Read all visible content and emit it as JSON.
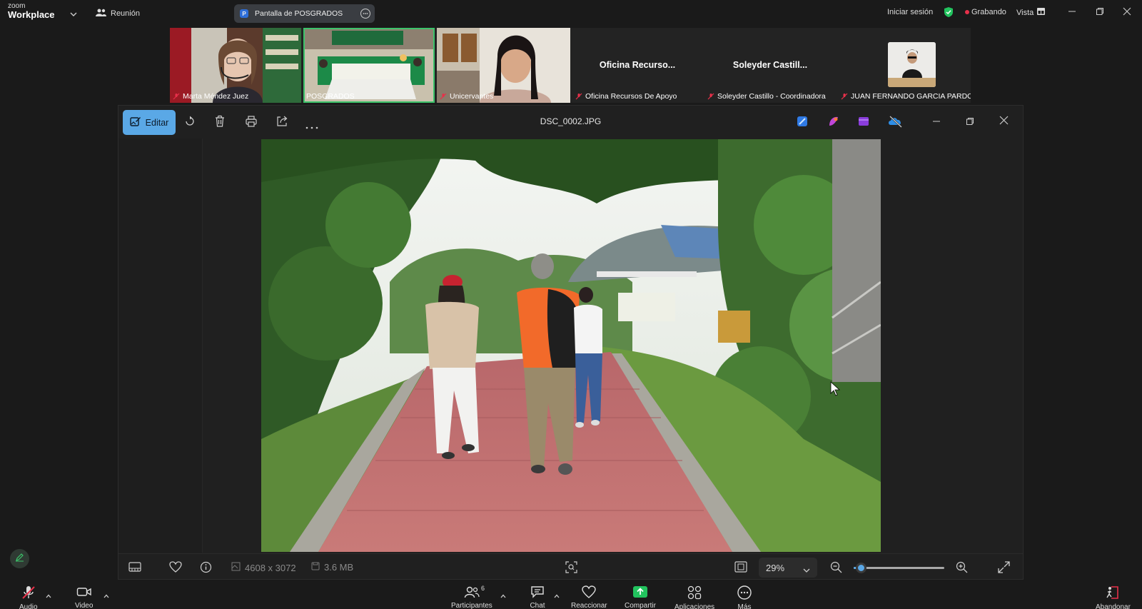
{
  "zoom_top": {
    "logo_small": "zoom",
    "logo_big": "Workplace",
    "meeting_label": "Reunión",
    "share_title": "Pantalla de POSGRADOS",
    "share_badge": "P",
    "sign_in": "Iniciar sesión",
    "recording": "Grabando",
    "view": "Vista"
  },
  "participants_strip": [
    {
      "name": "Marta Méndez Juez",
      "type": "video"
    },
    {
      "name": "POSGRADOS",
      "type": "video",
      "active": true
    },
    {
      "name": "Unicervantes",
      "type": "video"
    },
    {
      "name": "Oficina Recursos De Apoyo",
      "short": "Oficina  Recurso...",
      "type": "name"
    },
    {
      "name": "Soleyder Castillo - Coordinadora",
      "short": "Soleyder  Castill...",
      "type": "name"
    },
    {
      "name": "JUAN FERNANDO GARCIA PARDO",
      "type": "avatar"
    }
  ],
  "viewer": {
    "edit_label": "Editar",
    "file_name": "DSC_0002.JPG",
    "dimensions": "4608 x 3072",
    "file_size": "3.6 MB",
    "zoom_level": "29%",
    "zoom_fraction": 0.08
  },
  "zoom_bottom": {
    "audio": "Audio",
    "video": "Video",
    "participants": "Participantes",
    "participants_count": "6",
    "chat": "Chat",
    "react": "Reaccionar",
    "share": "Compartir",
    "apps": "Aplicaciones",
    "more": "Más",
    "leave": "Abandonar"
  },
  "colors": {
    "accent_blue": "#5aa8e6",
    "share_green": "#22c35e",
    "record_red": "#e8304a",
    "active_green": "#3cc36a"
  }
}
